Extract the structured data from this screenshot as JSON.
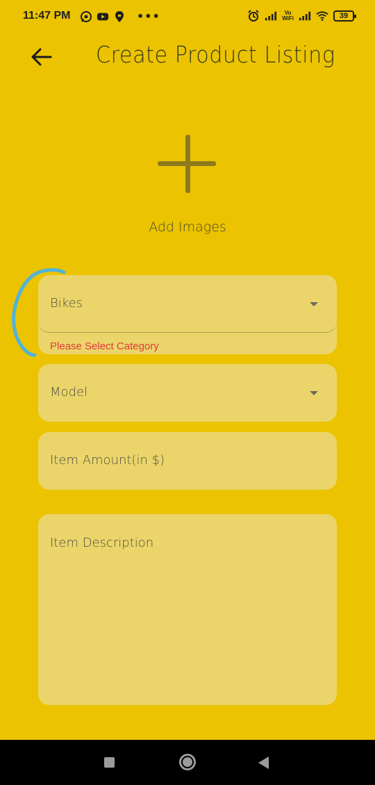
{
  "status_bar": {
    "time": "11:47 PM",
    "notification_icons": [
      "whatsapp-icon",
      "youtube-icon",
      "swiggy-icon"
    ],
    "more_indicator": "•••",
    "wifi_label_top": "Vo",
    "wifi_label_bottom": "WiFi",
    "battery_level": "39"
  },
  "app_bar": {
    "title": "Create Product Listing"
  },
  "add_images": {
    "label": "Add Images"
  },
  "form": {
    "category": {
      "value": "Bikes",
      "error": "Please Select Category"
    },
    "model": {
      "placeholder": "Model"
    },
    "item_amount": {
      "placeholder": "Item Amount(in $)"
    },
    "item_description": {
      "placeholder": "Item Description"
    }
  },
  "colors": {
    "background": "#EBC300",
    "field_fill": "#EBD56A",
    "error_text": "#E03B3B",
    "annotation_stroke": "#4FB3D9"
  }
}
